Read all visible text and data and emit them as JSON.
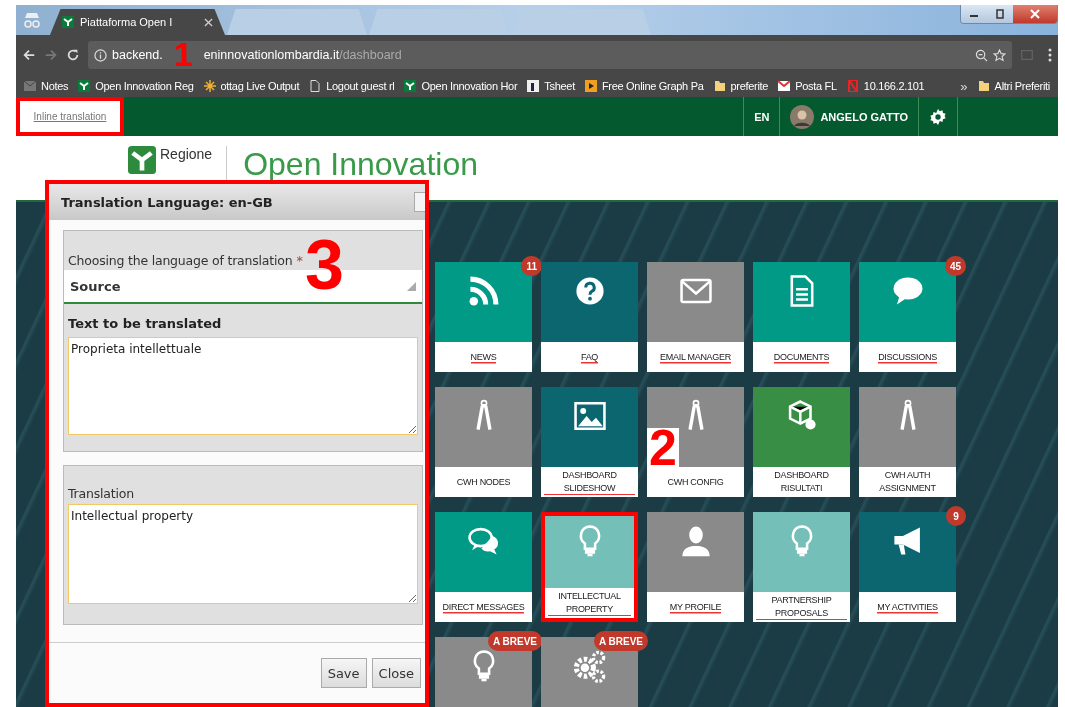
{
  "browser": {
    "tabs": [
      {
        "title": "Piattaforma Open I",
        "selected": true
      },
      {
        "selected": false
      },
      {
        "selected": false
      },
      {
        "selected": false
      }
    ],
    "url": {
      "host_start": "backend.",
      "annotation": "1",
      "host_rest": "eninnovationlombardia.it",
      "path": "/dashboard"
    },
    "bookmarks": [
      {
        "label": "Notes",
        "kind": "mail"
      },
      {
        "label": "Open Innovation Reg",
        "kind": "leaf"
      },
      {
        "label": "ottag Live Output",
        "kind": "burst"
      },
      {
        "label": "Logout guest rl",
        "kind": "page"
      },
      {
        "label": "Open Innovation Hor",
        "kind": "leaf"
      },
      {
        "label": "Tsheet",
        "kind": "fbox"
      },
      {
        "label": "Free Online Graph Pa",
        "kind": "play"
      },
      {
        "label": "preferite",
        "kind": "folder"
      },
      {
        "label": "Posta FL",
        "kind": "gmail"
      },
      {
        "label": "10.166.2.101",
        "kind": "redlogo"
      }
    ],
    "overflow": "»",
    "other_bookmarks": {
      "label": "Altri Preferiti",
      "kind": "folder"
    }
  },
  "topbar": {
    "inline_link": {
      "label": "Inline translation",
      "annotated": true
    },
    "language": "EN",
    "user": "ANGELO GATTO"
  },
  "header": {
    "logo_text": "Regione",
    "title": "Open Innovation"
  },
  "tiles": [
    {
      "label": "NEWS",
      "kind": "rss",
      "color": "#009a86",
      "badge": "11",
      "linked": true,
      "annotated": false
    },
    {
      "label": "FAQ",
      "kind": "question",
      "color": "#0b6670",
      "linked": true,
      "annotated": false
    },
    {
      "label": "EMAIL MANAGER",
      "kind": "envelope",
      "color": "#8a8a8a",
      "linked": true,
      "annotated": false
    },
    {
      "label": "DOCUMENTS",
      "kind": "document",
      "color": "#009a86",
      "linked": true,
      "annotated": false
    },
    {
      "label": "DISCUSSIONS",
      "kind": "bubble",
      "color": "#009a86",
      "badge": "45",
      "linked": true,
      "annotated": false
    },
    {
      "label": "CWH NODES",
      "kind": "keys",
      "color": "#8a8a8a",
      "linked": false,
      "annotated": false
    },
    {
      "label": "DASHBOARD SLIDESHOW",
      "kind": "picture",
      "color": "#0b6670",
      "linked": true,
      "annotated": false
    },
    {
      "label": "CWH CONFIG",
      "kind": "keys",
      "color": "#8a8a8a",
      "linked": false,
      "annotated": false,
      "annotation": "2"
    },
    {
      "label": "DASHBOARD RISULTATI",
      "kind": "cube",
      "color": "#388e44",
      "linked": false,
      "annotated": false
    },
    {
      "label": "CWH AUTH ASSIGNMENT",
      "kind": "keys",
      "color": "#8a8a8a",
      "linked": false,
      "annotated": false
    },
    {
      "label": "DIRECT MESSAGES",
      "kind": "chat",
      "color": "#009a86",
      "linked": true,
      "annotated": false
    },
    {
      "label": "INTELLECTUAL PROPERTY",
      "kind": "bulb",
      "color": "#74bfb8",
      "linked": true,
      "annotated": true
    },
    {
      "label": "MY PROFILE",
      "kind": "person",
      "color": "#8a8a8a",
      "linked": true,
      "annotated": false
    },
    {
      "label": "PARTNERSHIP PROPOSALS",
      "kind": "bulb",
      "color": "#74bfb8",
      "linked": true,
      "annotated": false
    },
    {
      "label": "MY ACTIVITIES",
      "kind": "megaphone",
      "color": "#0b6670",
      "badge": "9",
      "linked": true,
      "annotated": false
    },
    {
      "kind": "bulb",
      "color": "#8a8a8a",
      "badge": "A BREVE",
      "annotated": false
    },
    {
      "kind": "gears",
      "color": "#8a8a8a",
      "badge": "A BREVE",
      "annotated": false
    }
  ],
  "dialog": {
    "title": "Translation Language: en-GB",
    "annotated": true,
    "language_label": "Choosing the language of translation",
    "required_mark": "*",
    "language_value": "Source",
    "source_label": "Text to be translated",
    "source_text": "Proprieta intellettuale",
    "translation_label": "Translation",
    "translation_text": "Intellectual property",
    "buttons": [
      "Save",
      "Close"
    ]
  },
  "annotations": [
    {
      "label": "3"
    }
  ]
}
